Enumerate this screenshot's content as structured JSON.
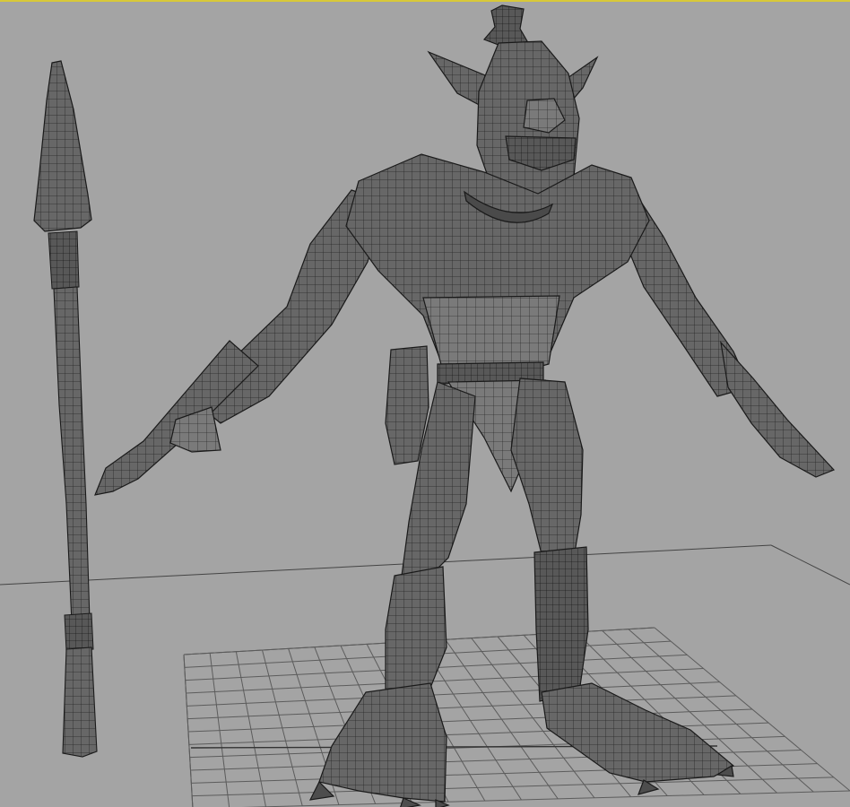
{
  "viewport": {
    "name": "perspective-viewport",
    "background": "#a4a4a4",
    "active_border_color": "#d8c838",
    "display_mode": "wireframe-on-shaded",
    "grid_visible": true
  },
  "scene": {
    "objects": [
      {
        "name": "spear",
        "type": "mesh"
      },
      {
        "name": "orc-character",
        "type": "mesh",
        "pose": "T-pose"
      }
    ],
    "shade_color": "#6a6a6a",
    "wire_color": "#1a1a1a"
  }
}
